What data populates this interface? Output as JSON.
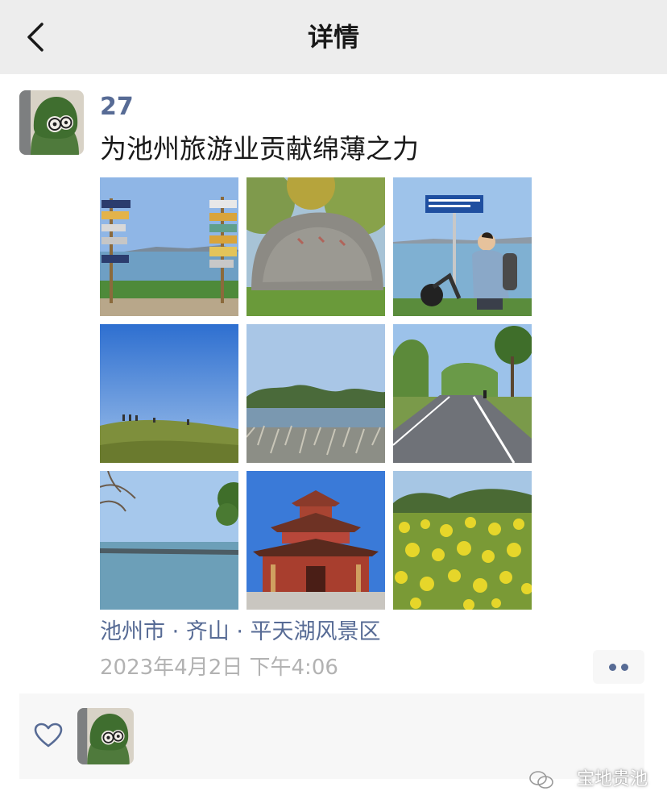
{
  "header": {
    "title": "详情"
  },
  "post": {
    "username": "27",
    "text": "为池州旅游业贡献绵薄之力",
    "location": "池州市 · 齐山 · 平天湖风景区",
    "timestamp": "2023年4月2日 下午4:06",
    "photos": [
      {
        "icon": "signpost-lake-photo"
      },
      {
        "icon": "rock-trees-photo"
      },
      {
        "icon": "person-sign-lake-photo"
      },
      {
        "icon": "grass-hill-photo"
      },
      {
        "icon": "lake-reeds-photo"
      },
      {
        "icon": "tree-lined-road-photo"
      },
      {
        "icon": "lake-branches-photo"
      },
      {
        "icon": "pavilion-photo"
      },
      {
        "icon": "rapeseed-flowers-photo"
      }
    ]
  },
  "watermark": {
    "text": "宝地贵池"
  },
  "colors": {
    "link": "#576b95",
    "header_bg": "#ededed",
    "panel_bg": "#f7f7f7",
    "time": "#b2b2b2"
  }
}
